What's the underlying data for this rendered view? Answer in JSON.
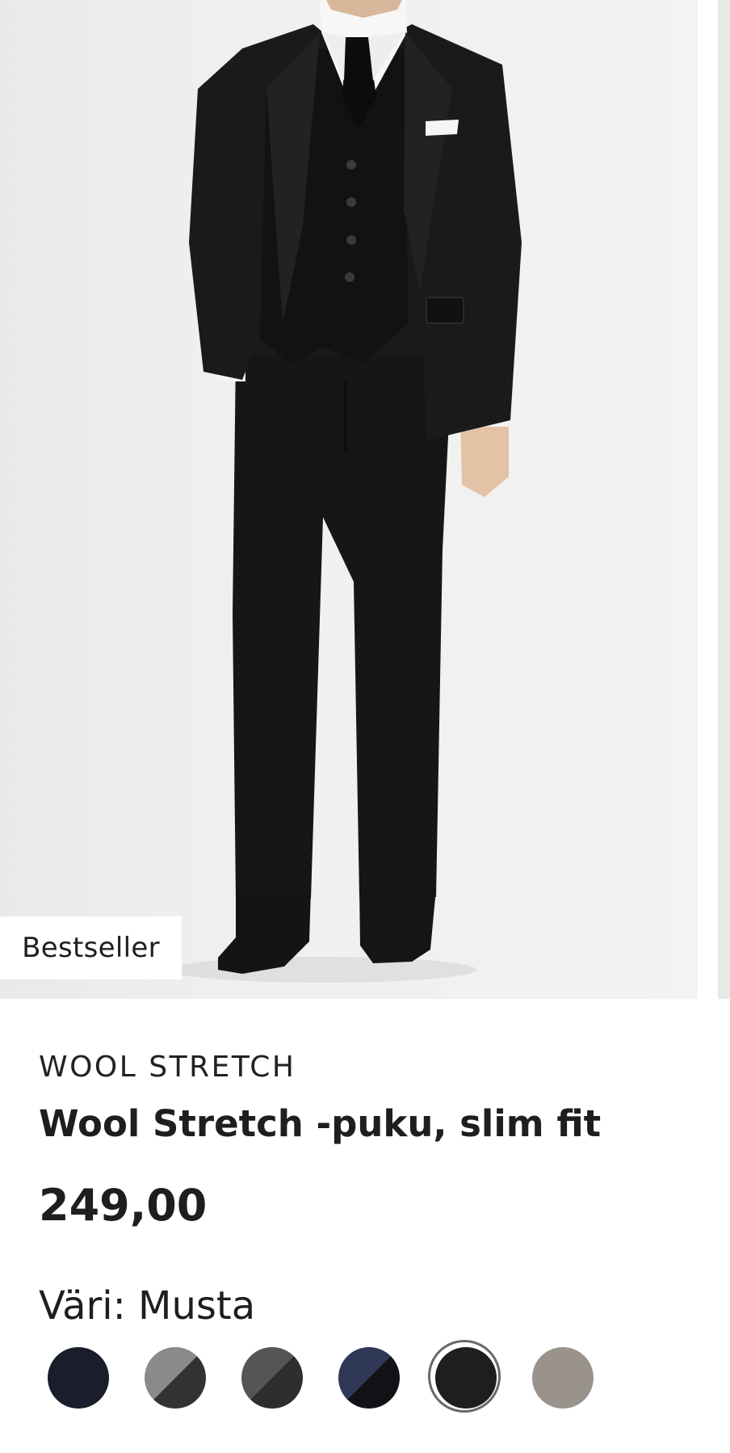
{
  "product": {
    "badge": "Bestseller",
    "brand": "WOOL STRETCH",
    "title": "Wool Stretch -puku, slim fit",
    "price": "249,00",
    "color_label": "Väri:",
    "color_value": "Musta",
    "image_alt": "Man wearing a black three-piece suit"
  },
  "swatches": [
    {
      "name": "navy",
      "colors": [
        "#1a1d2b",
        "#1a1d2b"
      ],
      "selected": false
    },
    {
      "name": "grey-charcoal",
      "colors": [
        "#8a8a8a",
        "#323232"
      ],
      "selected": false
    },
    {
      "name": "dark-grey",
      "colors": [
        "#555555",
        "#2e2e2e"
      ],
      "selected": false
    },
    {
      "name": "navy-black",
      "colors": [
        "#2f3756",
        "#111116"
      ],
      "selected": false
    },
    {
      "name": "black",
      "colors": [
        "#1e1e1e",
        "#1e1e1e"
      ],
      "selected": true
    },
    {
      "name": "taupe",
      "colors": [
        "#9a938b",
        "#9a938b"
      ],
      "selected": false
    }
  ]
}
